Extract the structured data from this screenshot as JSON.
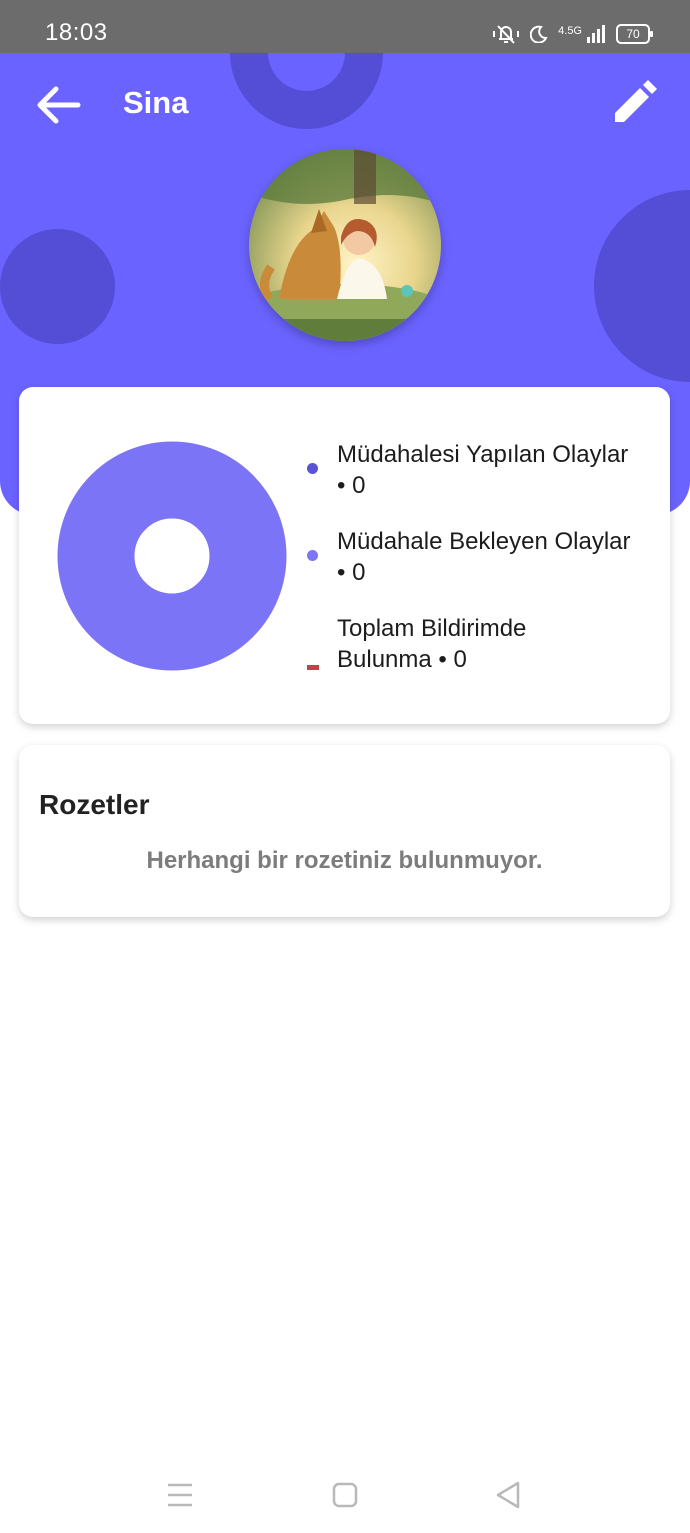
{
  "status_bar": {
    "time": "18:03",
    "network": "4.5G",
    "battery": "70"
  },
  "header": {
    "title": "Sina"
  },
  "stats": {
    "items": [
      {
        "label": "Müdahalesi Yapılan Olaylar",
        "value": "• 0",
        "color": "#5a52d5",
        "marker": "dot"
      },
      {
        "label": "Müdahale Bekleyen Olaylar",
        "value": "• 0",
        "color": "#7d75f3",
        "marker": "dot"
      },
      {
        "label": "Toplam Bildirimde",
        "label2": "Bulunma • 0",
        "color": "#c2414d",
        "marker": "bar"
      }
    ],
    "donut_color": "#7c74f6"
  },
  "badges": {
    "title": "Rozetler",
    "empty_text": "Herhangi bir rozetiniz bulunmuyor."
  },
  "colors": {
    "header_bg": "#6b63ff",
    "decor": "#544dd6",
    "status_bar": "#6c6c6c"
  }
}
